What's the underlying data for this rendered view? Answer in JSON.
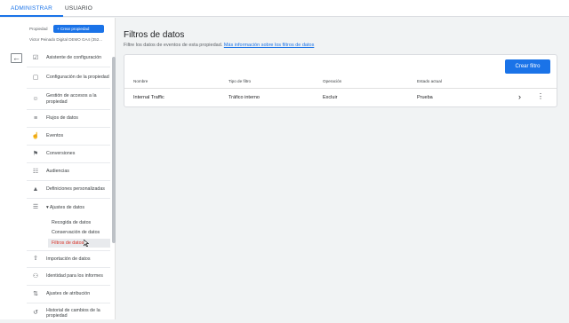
{
  "tabs": {
    "admin": "ADMINISTRAR",
    "user": "USUARIO"
  },
  "property": {
    "label": "Propiedad",
    "create_button": "+ Crear propiedad",
    "name": "Victor Peinado Digital DEMO GA4 (352..."
  },
  "nav": {
    "items": [
      {
        "label": "Asistente de configuración",
        "icon": "checklist-icon"
      },
      {
        "label": "Configuración de la propiedad",
        "icon": "property-settings-icon"
      },
      {
        "label": "Gestión de accesos a la propiedad",
        "icon": "people-icon"
      },
      {
        "label": "Flujos de datos",
        "icon": "data-streams-icon"
      },
      {
        "label": "Eventos",
        "icon": "events-icon"
      },
      {
        "label": "Conversiones",
        "icon": "flag-icon"
      },
      {
        "label": "Audiencias",
        "icon": "audiences-icon"
      },
      {
        "label": "Definiciones personalizadas",
        "icon": "custom-definitions-icon"
      },
      {
        "label": "Ajustes de datos",
        "icon": "database-icon"
      },
      {
        "label": "Importación de datos",
        "icon": "upload-icon"
      },
      {
        "label": "Identidad para los informes",
        "icon": "identity-icon"
      },
      {
        "label": "Ajustes de atribución",
        "icon": "attribution-icon"
      },
      {
        "label": "Historial de cambios de la propiedad",
        "icon": "history-icon"
      }
    ],
    "data_settings_sub": [
      "Recogida de datos",
      "Conservación de datos",
      "Filtros de datos"
    ]
  },
  "main": {
    "title": "Filtros de datos",
    "description": "Filtre los datos de eventos de esta propiedad.",
    "link": "Más información sobre los filtros de datos",
    "create_button": "Crear filtro",
    "columns": [
      "Nombre",
      "Tipo de filtro",
      "Operación",
      "Estado actual"
    ],
    "rows": [
      {
        "name": "Internal Traffic",
        "type": "Tráfico interno",
        "operation": "Excluir",
        "state": "Prueba"
      }
    ]
  }
}
